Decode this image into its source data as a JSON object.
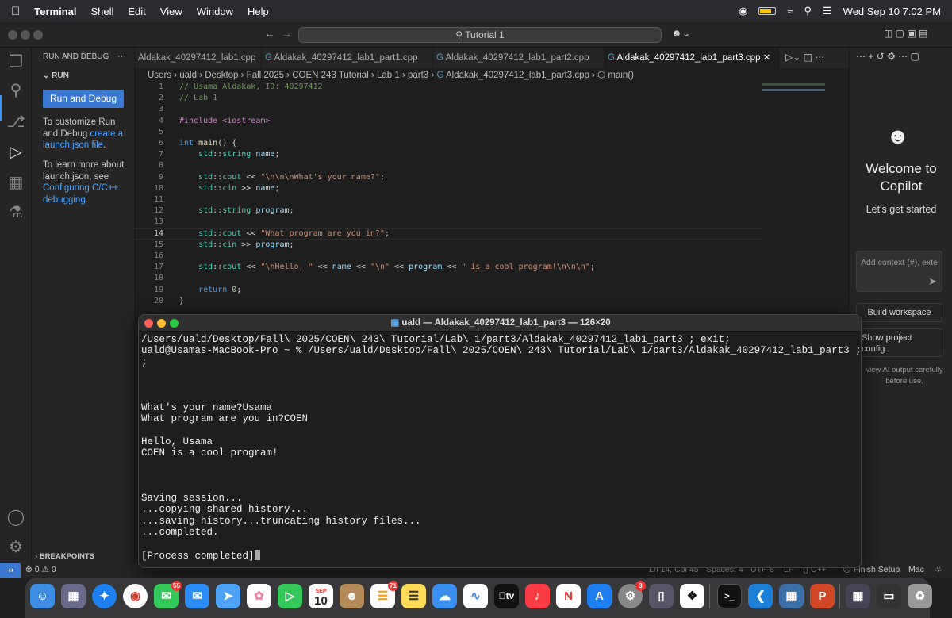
{
  "menubar": {
    "app_name": "Terminal",
    "items": [
      "Shell",
      "Edit",
      "View",
      "Window",
      "Help"
    ],
    "datetime": "Wed Sep 10  7:02 PM"
  },
  "vscode": {
    "command_center": "Tutorial 1",
    "sidebar": {
      "header": "RUN AND DEBUG",
      "section": "RUN",
      "run_button": "Run and Debug",
      "p1_text": "To customize Run and Debug ",
      "p1_link": "create a launch.json file",
      "p1_end": ".",
      "p2_text": "To learn more about launch.json, see ",
      "p2_link": "Configuring C/C++ debugging",
      "p2_end": ".",
      "breakpoints": "BREAKPOINTS"
    },
    "tabs": [
      {
        "label": "Aldakak_40297412_lab1.cpp"
      },
      {
        "label": "Aldakak_40297412_lab1_part1.cpp"
      },
      {
        "label": "Aldakak_40297412_lab1_part2.cpp"
      },
      {
        "label": "Aldakak_40297412_lab1_part3.cpp"
      }
    ],
    "breadcrumbs": [
      "Users",
      "uald",
      "Desktop",
      "Fall 2025",
      "COEN 243 Tutorial",
      "Lab 1",
      "part3",
      "Aldakak_40297412_lab1_part3.cpp",
      "main()"
    ],
    "code_lines": [
      "// Usama Aldakak, ID: 40297412",
      "// Lab 1",
      "",
      "#include <iostream>",
      "",
      "int main() {",
      "    std::string name;",
      "",
      "    std::cout << \"\\n\\n\\nWhat's your name?\";",
      "    std::cin >> name;",
      "",
      "    std::string program;",
      "",
      "    std::cout << \"What program are you in?\";",
      "    std::cin >> program;",
      "",
      "    std::cout << \"\\nHello, \" << name << \"\\n\" << program << \" is a cool program!\\n\\n\\n\";",
      "",
      "    return 0;",
      "}"
    ],
    "copilot": {
      "welcome": "Welcome to Copilot",
      "subtitle": "Let's get started",
      "input_placeholder": "Add context (#), exte",
      "build_workspace": "Build workspace",
      "show_project_config": "Show project config",
      "footer": "view AI output carefully before use."
    },
    "statusbar": {
      "errors": "0",
      "warnings": "0",
      "position": "Ln 14, Col 45",
      "spaces": "Spaces: 4",
      "encoding": "UTF-8",
      "eol": "LF",
      "language": "C++",
      "finish_setup": "Finish Setup",
      "platform": "Mac"
    }
  },
  "terminal": {
    "title": "uald — Aldakak_40297412_lab1_part3 — 126×20",
    "lines": [
      "/Users/uald/Desktop/Fall\\ 2025/COEN\\ 243\\ Tutorial/Lab\\ 1/part3/Aldakak_40297412_lab1_part3 ; exit;",
      "uald@Usamas-MacBook-Pro ~ % /Users/uald/Desktop/Fall\\ 2025/COEN\\ 243\\ Tutorial/Lab\\ 1/part3/Aldakak_40297412_lab1_part3 ; exit",
      ";",
      "",
      "",
      "",
      "What's your name?Usama",
      "What program are you in?COEN",
      "",
      "Hello, Usama",
      "COEN is a cool program!",
      "",
      "",
      "",
      "Saving session...",
      "...copying shared history...",
      "...saving history...truncating history files...",
      "...completed.",
      "",
      "[Process completed]"
    ]
  },
  "dock": {
    "badges": {
      "messages": "55",
      "reminders": "71",
      "settings": "3"
    },
    "calendar_month": "SEP",
    "calendar_day": "10",
    "tv_label": "tv"
  }
}
